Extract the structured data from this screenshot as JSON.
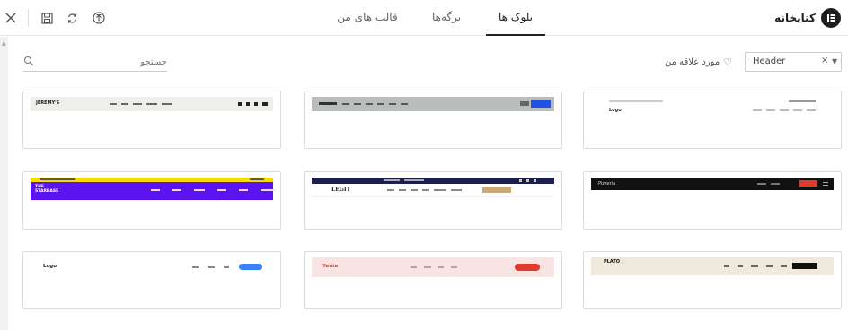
{
  "toolbar": {
    "icons": [
      "close-icon",
      "save-icon",
      "sync-icon",
      "upload-icon"
    ]
  },
  "tabs": [
    {
      "label": "بلوک ها",
      "active": true
    },
    {
      "label": "برگه‌ها",
      "active": false
    },
    {
      "label": "قالب های من",
      "active": false
    }
  ],
  "brand": {
    "title": "کتابخانه"
  },
  "search": {
    "placeholder": "جستجو"
  },
  "filter": {
    "value": "Header"
  },
  "favorites": {
    "label": "مورد علاقه من"
  },
  "templates": [
    {
      "name": "header-preview-1",
      "logo": "Logo"
    },
    {
      "name": "header-preview-2",
      "logo": ""
    },
    {
      "name": "header-preview-3",
      "logo": "JEREMY'S"
    },
    {
      "name": "header-preview-4",
      "logo": "Pizzeria"
    },
    {
      "name": "header-preview-5",
      "logo": "LEGIT"
    },
    {
      "name": "header-preview-6",
      "logo": "THE STARBASE"
    },
    {
      "name": "header-preview-7",
      "logo": "PLATO"
    },
    {
      "name": "header-preview-8",
      "logo": "Yeute"
    },
    {
      "name": "header-preview-9",
      "logo": "Logo"
    }
  ],
  "colors": {
    "accent": "#222222",
    "border": "#dcdcdc",
    "purple": "#5b14f0",
    "yellow": "#f5d90a",
    "red": "#e03a2a",
    "blue": "#3b82f6"
  }
}
